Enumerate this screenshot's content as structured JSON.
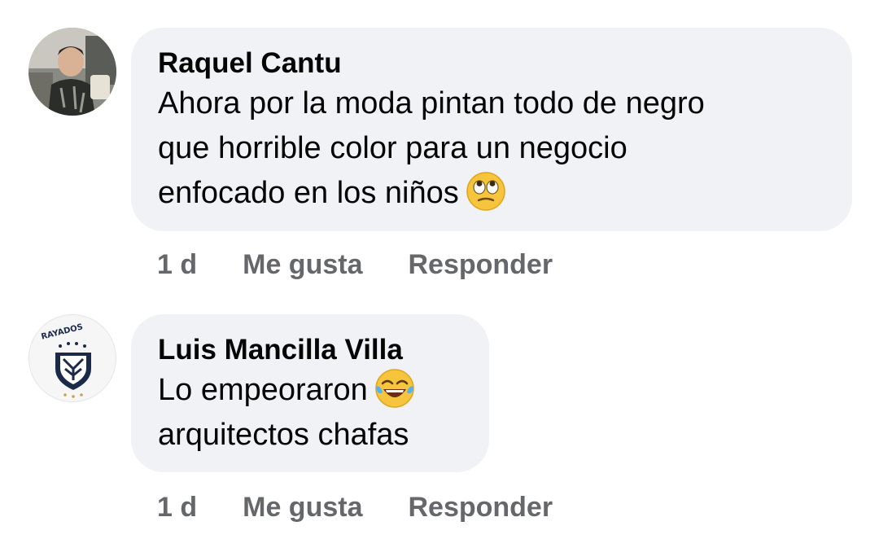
{
  "comments": [
    {
      "author": "Raquel Cantu",
      "lines": [
        "Ahora por la moda pintan todo de negro",
        "que horrible color para un negocio",
        "enfocado en los niños"
      ],
      "emoji": "face-with-rolling-eyes",
      "time": "1 d",
      "like_label": "Me gusta",
      "reply_label": "Responder"
    },
    {
      "author": "Luis Mancilla Villa",
      "lines": [
        "Lo empeoraron",
        "arquitectos chafas"
      ],
      "emoji": "face-with-tears-of-joy",
      "avatar_text": "RAYADOS",
      "time": "1 d",
      "like_label": "Me gusta",
      "reply_label": "Responder"
    }
  ],
  "colors": {
    "bubble": "#f0f2f5",
    "text": "#050505",
    "meta": "#65676b"
  }
}
